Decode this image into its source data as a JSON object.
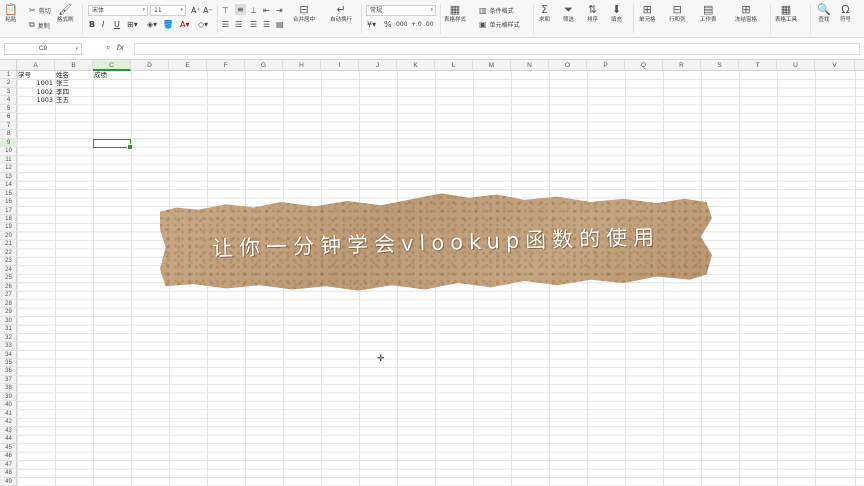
{
  "ribbon": {
    "paste": "粘贴",
    "cut": "剪切",
    "copy": "复制",
    "format_painter": "格式刷",
    "font_name": "宋体",
    "font_size": "11",
    "merge_center": "合并居中",
    "wrap_text": "自动换行",
    "number_format": "常规",
    "currency_symbol": "¥",
    "percent_symbol": "%",
    "thousands_symbol": "000",
    "decimal_inc": "+.0",
    "decimal_dec": ".00",
    "table_style": "表格样式",
    "conditional_format": "条件格式",
    "cell_style": "单元格样式",
    "sum": "求和",
    "filter": "筛选",
    "sort": "排序",
    "fill": "填充",
    "cell": "单元格",
    "row_col": "行和列",
    "worksheet": "工作表",
    "freeze": "冻结窗格",
    "table_tools": "表格工具",
    "find": "查找",
    "symbol": "符号"
  },
  "formula_bar": {
    "name_box": "C9",
    "fx": "fx",
    "formula": ""
  },
  "columns": [
    "A",
    "B",
    "C",
    "D",
    "E",
    "F",
    "G",
    "H",
    "I",
    "J",
    "K",
    "L",
    "M",
    "N",
    "O",
    "P",
    "Q",
    "R",
    "S",
    "T",
    "U",
    "V"
  ],
  "selected_column": "C",
  "selected_row": 9,
  "row_count": 49,
  "cells": {
    "A1": "学号",
    "B1": "姓名",
    "C1": "成绩",
    "A2": "1001",
    "B2": "张三",
    "A3": "1002",
    "B3": "李四",
    "A4": "1003",
    "B4": "王五"
  },
  "banner": {
    "text": "让你一分钟学会vlookup函数的使用"
  },
  "icons": {
    "paste": "clipboard-icon",
    "cut": "scissors-icon",
    "copy": "copy-icon",
    "format_painter": "brush-icon",
    "sum": "sigma-icon",
    "filter": "funnel-icon",
    "sort": "sort-icon",
    "find": "magnifier-icon",
    "cursor": "crosshair-cursor-icon"
  }
}
